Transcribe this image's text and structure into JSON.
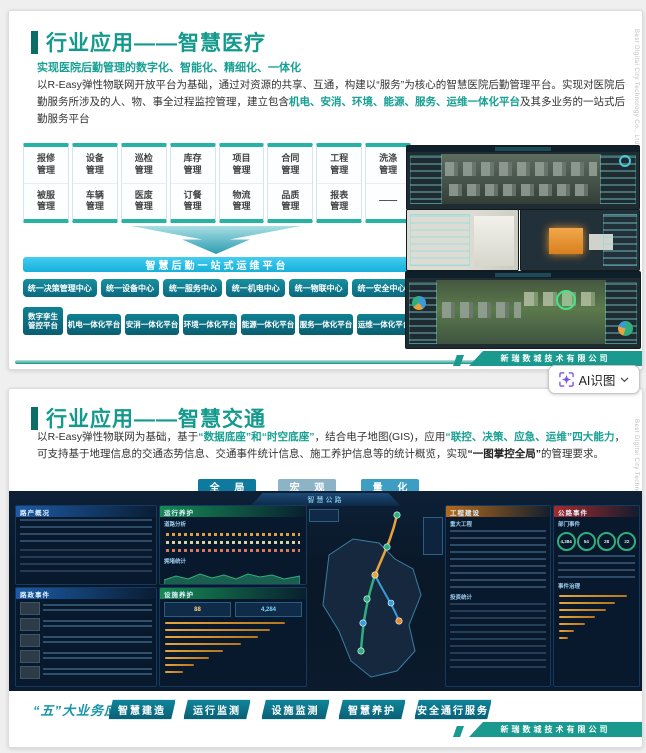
{
  "slide1": {
    "side_text": "Best Digital City Technology Co., Ltd",
    "title": "行业应用——智慧医疗",
    "subtitle": "实现医院后勤管理的数字化、智能化、精细化、一体化",
    "para": {
      "p1": "以R-Easy弹性物联网开放平台为基础，通过对资源的共享、互通，构建以“服务”为核心的智慧医院后勤管理平台。实现对医院后勤服务所涉及的人、物、事全过程监控管理，建立包含",
      "p2": "机电、安消、环境、能源、服务、运维一体化平台",
      "p3": "及其多业务的一站式后勤服务平台"
    },
    "modules_row1": [
      "报修管理",
      "设备管理",
      "巡检管理",
      "库存管理",
      "项目管理",
      "合同管理",
      "工程管理",
      "洗涤管理"
    ],
    "modules_row2": [
      "被服管理",
      "车辆管理",
      "医废管理",
      "订餐管理",
      "物流管理",
      "品质管理",
      "报表管理",
      "——"
    ],
    "platform_bar": "智慧后勤一站式运维平台",
    "centers": [
      "统一决策管理中心",
      "统一设备中心",
      "统一服务中心",
      "统一机电中心",
      "统一物联中心",
      "统一安全中心"
    ],
    "platforms": [
      "数字孪生管控平台",
      "机电一体化平台",
      "安消一体化平台",
      "环境一体化平台",
      "能源一体化平台",
      "服务一体化平台",
      "运维一体化平台"
    ],
    "company": "新瑞数城技术有限公司"
  },
  "ai_button": {
    "label": "AI识图",
    "icon_color": "#7a52e0"
  },
  "slide2": {
    "side_text": "Best Digital City Technology Co., Ltd",
    "title": "行业应用——智慧交通",
    "para": {
      "p1": "以R-Easy弹性物联网为基础，基于",
      "p2": "“数据底座”和“时空底座”",
      "p3": "，结合电子地图(GIS)，应用",
      "p4": "“联控、决策、应急、运维”四大能力",
      "p5": "，可支持基于地理信息的交通态势信息、交通事件统计信息、施工养护信息等的统计概览，实现",
      "p6": "“一图掌控全局”",
      "p7": "的管理要求。"
    },
    "view_buttons": [
      "全 局",
      "宏 观",
      "量 化"
    ],
    "dashboard": {
      "header": "智慧公路",
      "road_overview": "路产概况",
      "road_analysis": "道路分析",
      "congestion": "拥堵统计",
      "operation": "运行养护",
      "road_events": "路政事件",
      "facility": "设施养护",
      "construction": "工程建设",
      "major_projects": "重大工程",
      "investment": "投资统计",
      "highway_events": "公路事件",
      "dept_events": "部门事件",
      "event_mgmt": "事件治理",
      "gauges": [
        "4,384",
        "54",
        "28",
        "22"
      ],
      "facility_stats": [
        "88",
        "4,284"
      ]
    },
    "biz_label": "“五”大业务应用",
    "biz_buttons": [
      "智慧建造",
      "运行监测",
      "设施监测",
      "智慧养护",
      "安全通行服务"
    ],
    "company": "新瑞数城技术有限公司"
  }
}
